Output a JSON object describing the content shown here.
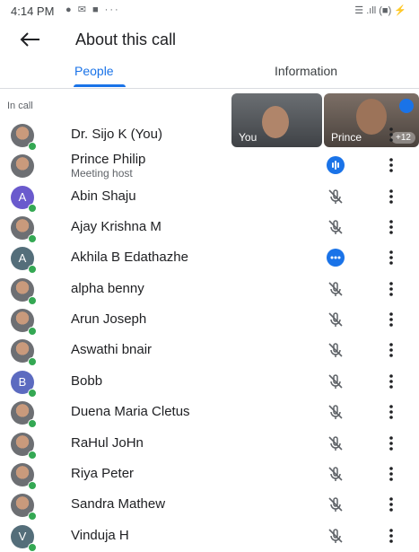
{
  "status_bar": {
    "time": "4:14 PM",
    "icons_left": "● ✉ ■ ···",
    "icons_right": "☰ .ıll (■) ⚡"
  },
  "header": {
    "title": "About this call"
  },
  "tabs": [
    {
      "label": "People",
      "selected": true
    },
    {
      "label": "Information",
      "selected": false
    }
  ],
  "section_label": "In call",
  "tiles": [
    {
      "name": "You"
    },
    {
      "name": "Prince",
      "overflow": "+12"
    }
  ],
  "participants": [
    {
      "name": "Dr. Sijo K (You)",
      "avatar": "photo",
      "status": "none"
    },
    {
      "name": "Prince Philip",
      "subtitle": "Meeting host",
      "avatar": "photo",
      "status": "speaking"
    },
    {
      "name": "Abin Shaju",
      "avatar": "A",
      "avatar_color": "#6a5acd",
      "status": "muted"
    },
    {
      "name": "Ajay Krishna M",
      "avatar": "photo",
      "status": "muted"
    },
    {
      "name": "Akhila B Edathazhe",
      "avatar": "A",
      "avatar_color": "#546e7a",
      "status": "active"
    },
    {
      "name": "alpha benny",
      "avatar": "photo",
      "status": "muted"
    },
    {
      "name": "Arun Joseph",
      "avatar": "photo",
      "status": "muted"
    },
    {
      "name": "Aswathi bnair",
      "avatar": "photo",
      "status": "muted"
    },
    {
      "name": "Bobb",
      "avatar": "B",
      "avatar_color": "#5c6bc0",
      "status": "muted"
    },
    {
      "name": "Duena Maria Cletus",
      "avatar": "photo",
      "status": "muted"
    },
    {
      "name": "RaHul JoHn",
      "avatar": "photo",
      "status": "muted"
    },
    {
      "name": "Riya Peter",
      "avatar": "photo",
      "status": "muted"
    },
    {
      "name": "Sandra Mathew",
      "avatar": "photo",
      "status": "muted"
    },
    {
      "name": "Vinduja H",
      "avatar": "V",
      "avatar_color": "#546e7a",
      "status": "muted"
    }
  ],
  "colors": {
    "accent": "#1a73e8",
    "online": "#34a853"
  }
}
